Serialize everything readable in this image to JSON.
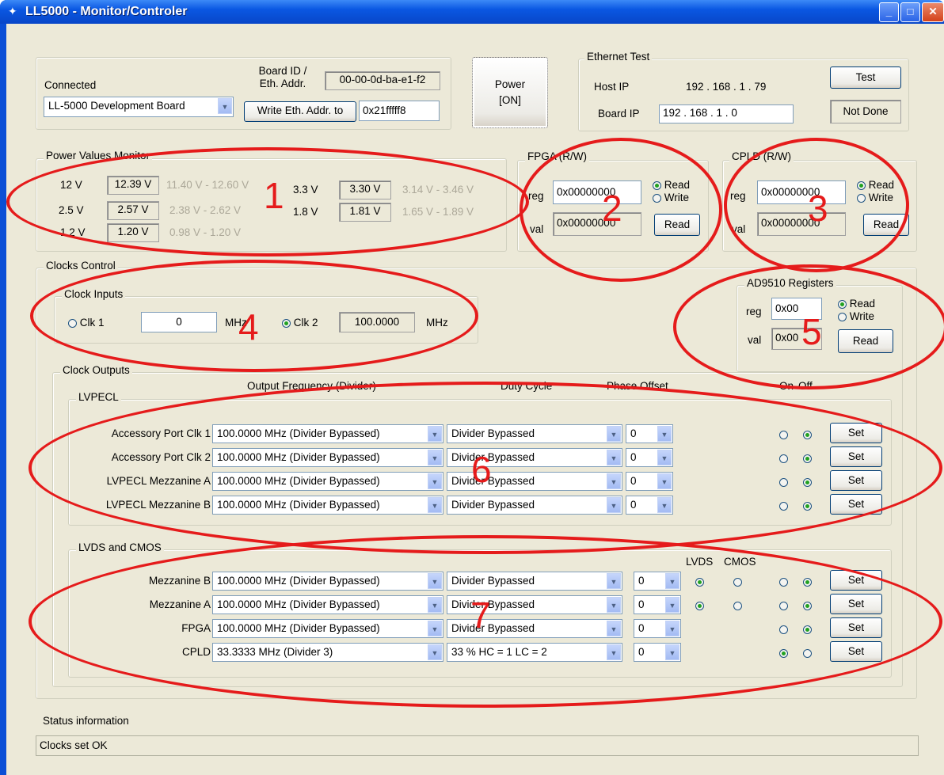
{
  "window": {
    "title": "LL5000 - Monitor/Controler",
    "app_icon": "app-icon"
  },
  "top": {
    "connected_label": "Connected",
    "board_select": "LL-5000 Development Board",
    "board_id_label_1": "Board ID /",
    "board_id_label_2": "Eth. Addr.",
    "board_id_value": "00-00-0d-ba-e1-f2",
    "write_eth_button": "Write Eth. Addr. to",
    "write_eth_value": "0x21fffff8",
    "power_line1": "Power",
    "power_line2": "[ON]"
  },
  "ethernet": {
    "title": "Ethernet Test",
    "host_ip_label": "Host IP",
    "host_ip": "192 . 168 . 1 . 79",
    "board_ip_label": "Board IP",
    "board_ip": "192  .  168  .   1   .   0",
    "test_button": "Test",
    "status": "Not Done"
  },
  "power_monitor": {
    "title": "Power Values Monitor",
    "rows": [
      {
        "label": "12 V",
        "value": "12.39 V",
        "range": "11.40 V - 12.60 V"
      },
      {
        "label": "2.5 V",
        "value": "2.57 V",
        "range": "2.38 V - 2.62 V"
      },
      {
        "label": "1.2 V",
        "value": "1.20 V",
        "range": "0.98 V - 1.20 V"
      },
      {
        "label": "3.3 V",
        "value": "3.30 V",
        "range": "3.14 V - 3.46 V"
      },
      {
        "label": "1.8 V",
        "value": "1.81 V",
        "range": "1.65 V - 1.89 V"
      }
    ]
  },
  "fpga": {
    "title": "FPGA (R/W)",
    "reg_label": "reg",
    "reg_value": "0x00000000",
    "val_label": "val",
    "val_value": "0x00000000",
    "read_label": "Read",
    "write_label": "Write",
    "read_button": "Read"
  },
  "cpld": {
    "title": "CPLD (R/W)",
    "reg_label": "reg",
    "reg_value": "0x00000000",
    "val_label": "val",
    "val_value": "0x00000000",
    "read_label": "Read",
    "write_label": "Write",
    "read_button": "Read"
  },
  "clocks": {
    "title": "Clocks Control",
    "inputs_title": "Clock Inputs",
    "clk1_label": "Clk 1",
    "clk1_value": "0",
    "clk1_unit": "MHz",
    "clk2_label": "Clk 2",
    "clk2_value": "100.0000",
    "clk2_unit": "MHz"
  },
  "ad9510": {
    "title": "AD9510 Registers",
    "reg_label": "reg",
    "reg_value": "0x00",
    "val_label": "val",
    "val_value": "0x00",
    "read_label": "Read",
    "write_label": "Write",
    "read_button": "Read"
  },
  "outputs": {
    "title": "Clock Outputs",
    "col_freq": "Output Frequency (Divider)",
    "col_duty": "Duty Cycle",
    "col_phase": "Phase Offset",
    "col_on": "On",
    "col_off": "Off",
    "lvds_col": "LVDS",
    "cmos_col": "CMOS",
    "set": "Set",
    "lvpecl_title": "LVPECL",
    "lvpecl": [
      {
        "name": "Accessory Port Clk 1",
        "freq": "100.0000 MHz   (Divider Bypassed)",
        "duty": "Divider Bypassed",
        "phase": "0"
      },
      {
        "name": "Accessory Port Clk 2",
        "freq": "100.0000 MHz   (Divider Bypassed)",
        "duty": "Divider Bypassed",
        "phase": "0"
      },
      {
        "name": "LVPECL Mezzanine A",
        "freq": "100.0000 MHz   (Divider Bypassed)",
        "duty": "Divider Bypassed",
        "phase": "0"
      },
      {
        "name": "LVPECL Mezzanine B",
        "freq": "100.0000 MHz   (Divider Bypassed)",
        "duty": "Divider Bypassed",
        "phase": "0"
      }
    ],
    "lvds_title": "LVDS and CMOS",
    "lvds": [
      {
        "name": "Mezzanine B",
        "freq": "100.0000 MHz   (Divider Bypassed)",
        "duty": "Divider Bypassed",
        "phase": "0"
      },
      {
        "name": "Mezzanine A",
        "freq": "100.0000 MHz   (Divider Bypassed)",
        "duty": "Divider Bypassed",
        "phase": "0"
      },
      {
        "name": "FPGA",
        "freq": "100.0000 MHz   (Divider Bypassed)",
        "duty": "Divider Bypassed",
        "phase": "0"
      },
      {
        "name": "CPLD",
        "freq": "33.3333 MHz   (Divider 3)",
        "duty": "33 %   HC = 1   LC = 2",
        "phase": "0"
      }
    ]
  },
  "status": {
    "label": "Status information",
    "text": "Clocks set OK"
  },
  "annotations": {
    "n1": "1",
    "n2": "2",
    "n3": "3",
    "n4": "4",
    "n5": "5",
    "n6": "6",
    "n7": "7",
    "color": "#e51b1b"
  }
}
